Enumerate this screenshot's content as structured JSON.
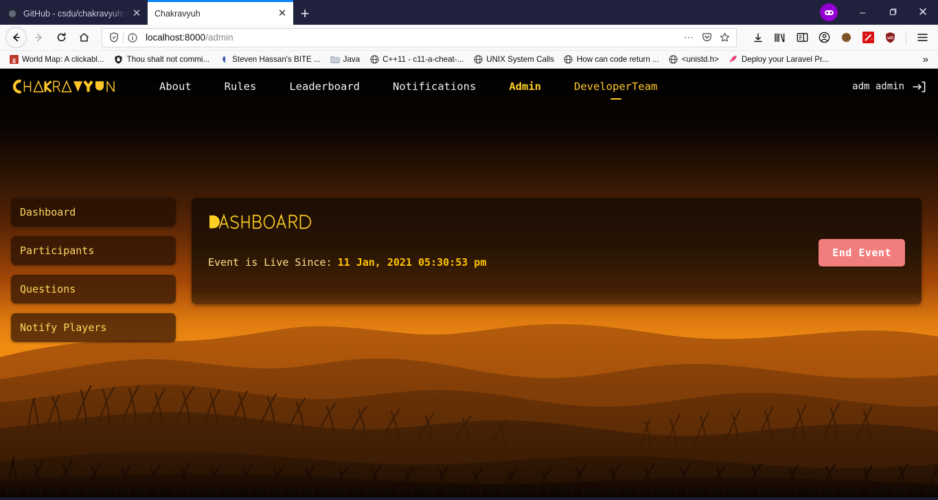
{
  "browser": {
    "tabs": [
      {
        "title": "GitHub - csdu/chakravyuh: Cha",
        "active": false,
        "favicon": "github-icon"
      },
      {
        "title": "Chakravyuh",
        "active": true,
        "favicon": "none"
      }
    ],
    "new_tab_label": "+",
    "close_label": "✕",
    "window": {
      "container_badge": "mask-icon",
      "minimize": "–",
      "maximize": "❐",
      "close": "✕"
    },
    "toolbar": {
      "back": "←",
      "forward": "→",
      "reload": "↻",
      "home": "⌂",
      "page_actions": "⋯",
      "pocket": "pocket-icon",
      "bookmark_star": "☆",
      "downloads": "download-icon",
      "library": "library-icon",
      "sidebar": "sidebar-icon",
      "account": "account-icon",
      "cookie_ext": "cookie-icon",
      "wand_ext": "magic-wand-icon",
      "ublock_ext": "ublock-icon",
      "menu": "☰"
    },
    "url": {
      "host": "localhost:8000",
      "path": "/admin",
      "shield": "shield-icon",
      "info": "ⓘ"
    },
    "bookmarks": [
      {
        "label": "World Map: A clickabl...",
        "icon": "g-icon"
      },
      {
        "label": "Thou shalt not commi...",
        "icon": "shield-icon"
      },
      {
        "label": "Steven Hassan's BITE ...",
        "icon": "site-icon"
      },
      {
        "label": "Java",
        "icon": "folder-icon"
      },
      {
        "label": "C++11 - c11-a-cheat-...",
        "icon": "globe-icon"
      },
      {
        "label": "UNIX System Calls",
        "icon": "globe-icon"
      },
      {
        "label": "How can code return ...",
        "icon": "globe-icon"
      },
      {
        "label": "<unistd.h>",
        "icon": "globe-icon"
      },
      {
        "label": "Deploy your Laravel Pr...",
        "icon": "rocket-icon"
      }
    ],
    "bookmarks_overflow": "»"
  },
  "site": {
    "logo_text": "CHAKRAVYUH",
    "nav": [
      {
        "label": "About",
        "state": "normal"
      },
      {
        "label": "Rules",
        "state": "normal"
      },
      {
        "label": "Leaderboard",
        "state": "normal"
      },
      {
        "label": "Notifications",
        "state": "normal"
      },
      {
        "label": "Admin",
        "state": "active"
      },
      {
        "label": "DeveloperTeam",
        "state": "devteam"
      }
    ],
    "user": {
      "name": "adm admin",
      "logout_icon": "logout-icon"
    },
    "sidebar": [
      {
        "label": "Dashboard"
      },
      {
        "label": "Participants"
      },
      {
        "label": "Questions"
      },
      {
        "label": "Notify Players"
      }
    ],
    "dashboard": {
      "title": "DASHBOARD",
      "live_label": "Event is Live Since:",
      "live_date": "11 Jan, 2021 05:30:53 pm",
      "end_event_label": "End Event"
    },
    "colors": {
      "accent_yellow": "#ffd024",
      "logo_yellow": "#ffc72c",
      "end_button": "#f27d7d",
      "panel_dark": "#1d0d03",
      "sky_orange": "#ef8b12"
    }
  }
}
